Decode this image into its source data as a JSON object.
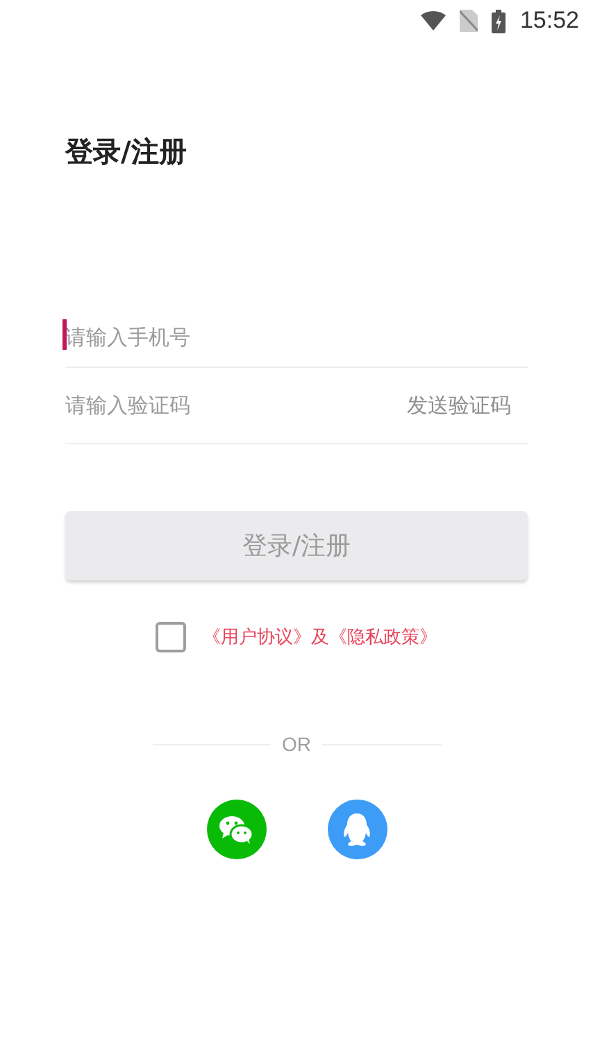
{
  "status_bar": {
    "time": "15:52"
  },
  "title": "登录/注册",
  "phone_field": {
    "placeholder": "请输入手机号",
    "focused": true
  },
  "code_field": {
    "placeholder": "请输入验证码",
    "send_code": "发送验证码"
  },
  "submit_button": {
    "label": "登录/注册",
    "disabled": true
  },
  "agreement": {
    "checked": false,
    "text": "《用户协议》及《隐私政策》"
  },
  "divider_label": "OR",
  "social_logins": [
    {
      "kind": "wechat"
    },
    {
      "kind": "qq"
    }
  ]
}
